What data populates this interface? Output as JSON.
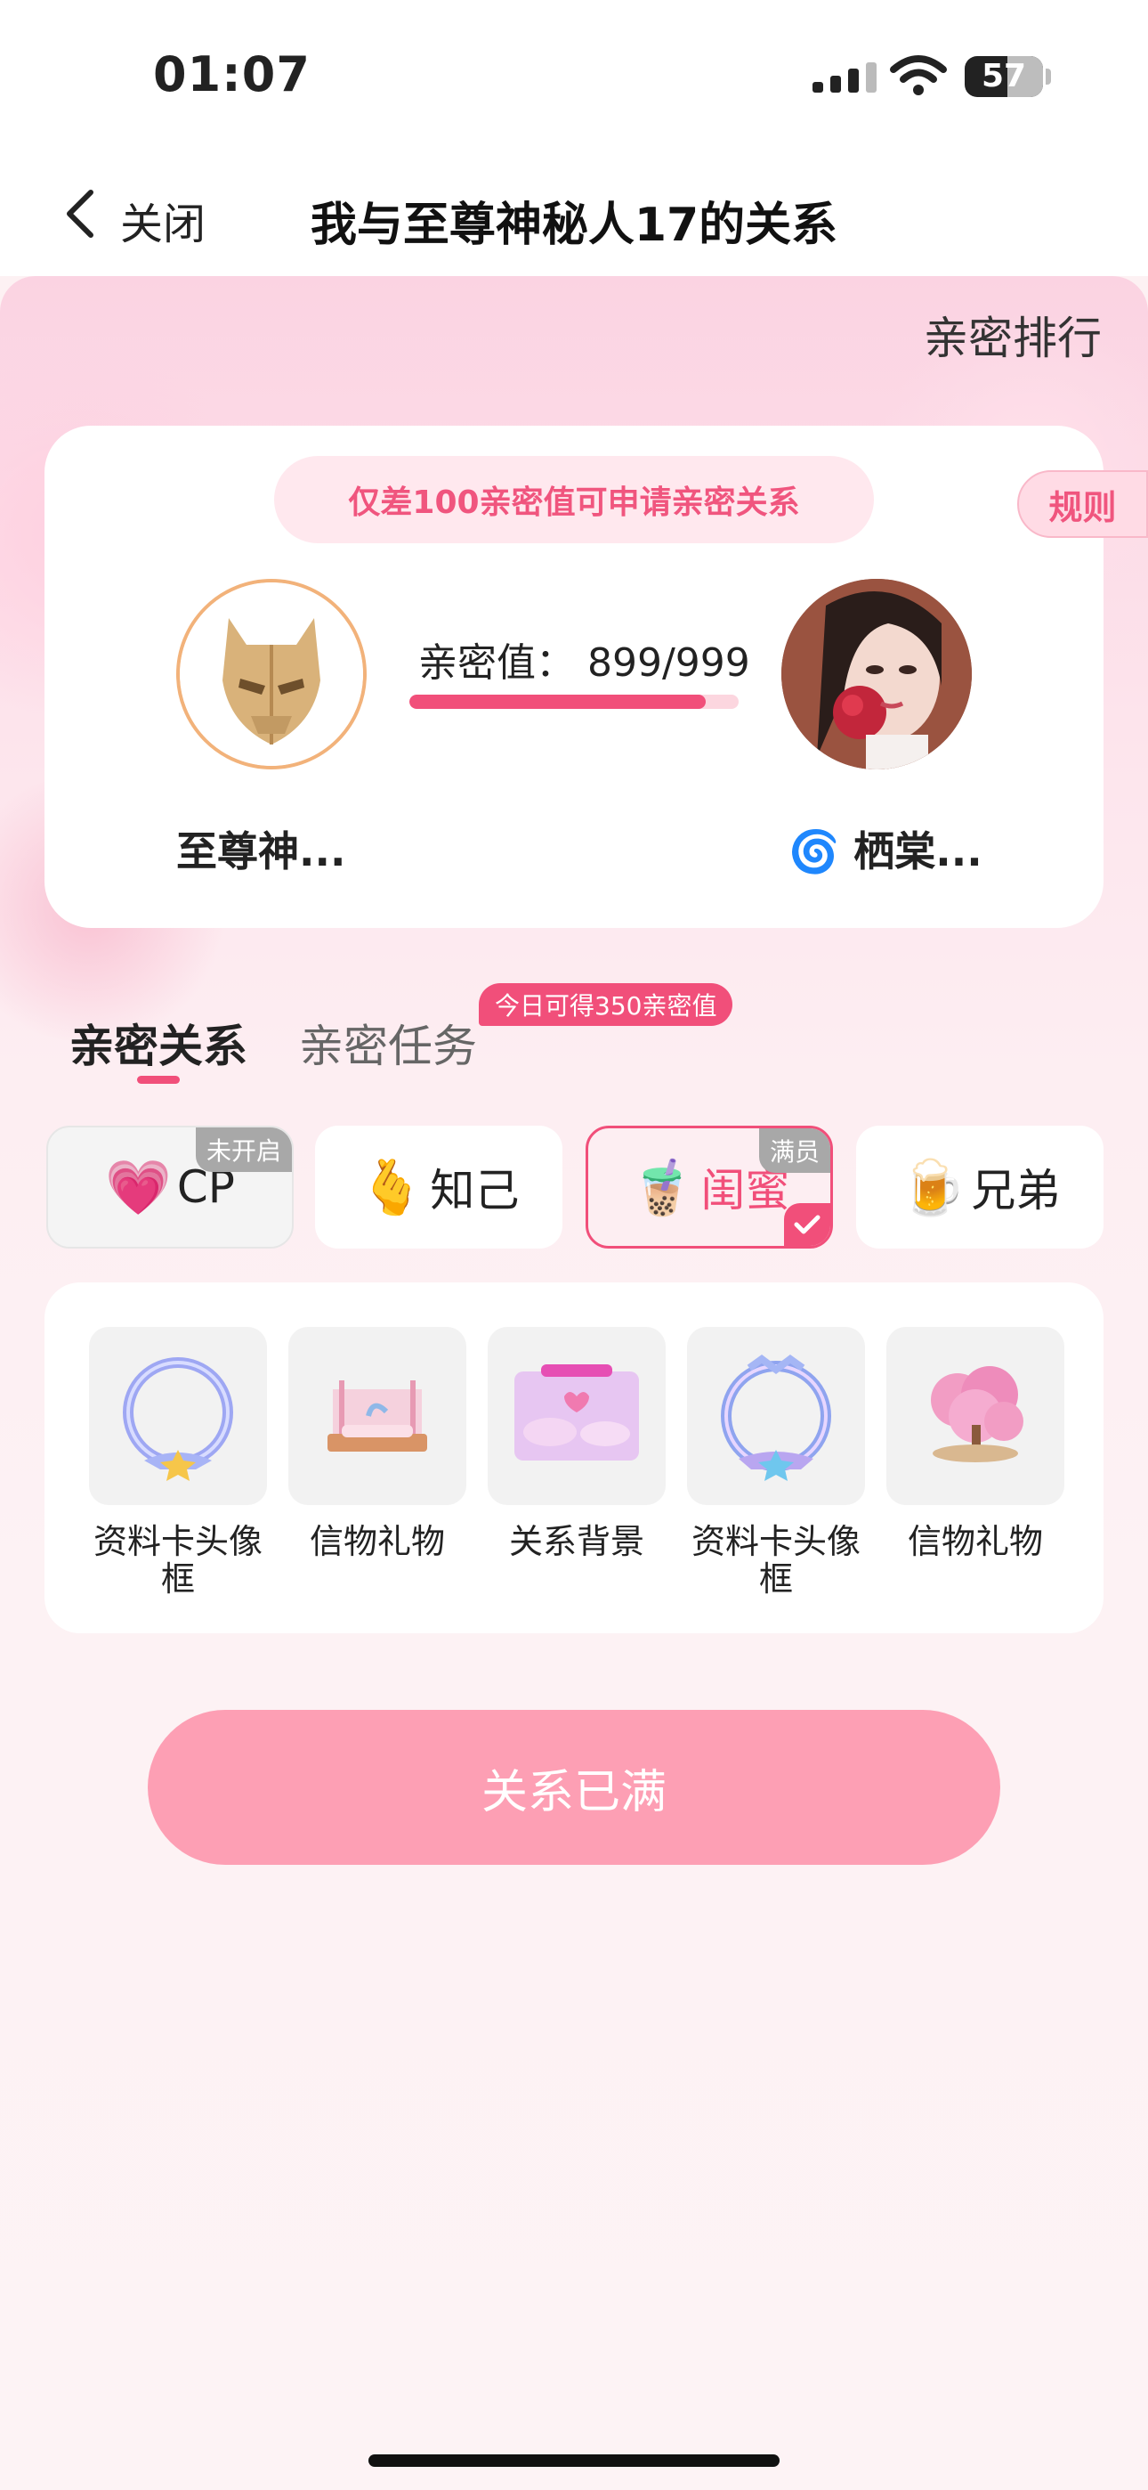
{
  "status_bar": {
    "time": "01:07",
    "battery": "57"
  },
  "nav": {
    "close_label": "关闭",
    "title": "我与至尊神秘人17的关系"
  },
  "rank_link": "亲密排行",
  "card": {
    "hint": "仅差100亲密值可申请亲密关系",
    "rules": "规则",
    "score_label": "亲密值：",
    "score_value": "899/999",
    "progress": 0.9,
    "left_name": "至尊神...",
    "right_name": "🌀 栖棠..."
  },
  "tabs": [
    {
      "label": "亲密关系",
      "active": true
    },
    {
      "label": "亲密任务",
      "badge": "今日可得350亲密值"
    }
  ],
  "relations": [
    {
      "icon": "heart-pulse-icon",
      "emoji": "💗",
      "label": "CP",
      "tag": "未开启",
      "state": "disabled"
    },
    {
      "icon": "finger-heart-icon",
      "emoji": "🫰",
      "label": "知己"
    },
    {
      "icon": "bubble-tea-icon",
      "emoji": "🧋",
      "label": "闺蜜",
      "tag": "满员",
      "state": "selected"
    },
    {
      "icon": "beer-mug-icon",
      "emoji": "🍺",
      "label": "兄弟"
    }
  ],
  "rewards": [
    {
      "label": "资料卡头像框",
      "icon": "avatar-frame-icon"
    },
    {
      "label": "信物礼物",
      "icon": "gift-bed-icon"
    },
    {
      "label": "关系背景",
      "icon": "relation-background-icon"
    },
    {
      "label": "资料卡头像框",
      "icon": "avatar-frame-icon"
    },
    {
      "label": "信物礼物",
      "icon": "sakura-tree-icon"
    }
  ],
  "action_button": "关系已满",
  "colors": {
    "accent": "#f14f7a",
    "button": "#fd9fb4",
    "tag_gray": "#a8a8a8"
  }
}
